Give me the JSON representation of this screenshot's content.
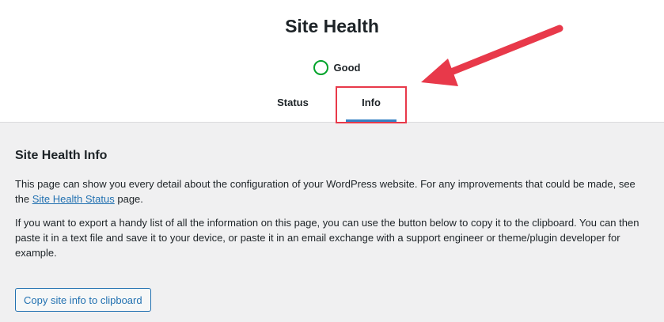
{
  "page": {
    "title": "Site Health"
  },
  "status": {
    "label": "Good",
    "color": "#00a32a"
  },
  "tabs": [
    {
      "label": "Status",
      "active": false
    },
    {
      "label": "Info",
      "active": true
    }
  ],
  "annotation": {
    "box_color": "#e8394a",
    "arrow_color": "#e8394a"
  },
  "info": {
    "heading": "Site Health Info",
    "para1_before_link": "This page can show you every detail about the configuration of your WordPress website. For any improvements that could be made, see the ",
    "para1_link": "Site Health Status",
    "para1_after_link": " page.",
    "para2": "If you want to export a handy list of all the information on this page, you can use the button below to copy it to the clipboard. You can then paste it in a text file and save it to your device, or paste it in an email exchange with a support engineer or theme/plugin developer for example.",
    "copy_button_label": "Copy site info to clipboard"
  },
  "colors": {
    "accent": "#2271b1",
    "tab_underline": "#3582c4"
  }
}
